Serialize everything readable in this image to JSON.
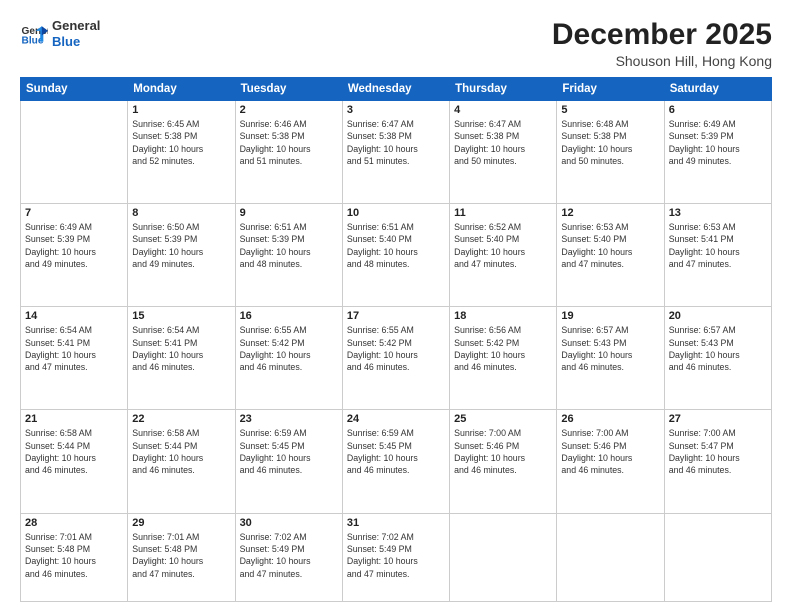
{
  "logo": {
    "line1": "General",
    "line2": "Blue"
  },
  "title": "December 2025",
  "subtitle": "Shouson Hill, Hong Kong",
  "days_header": [
    "Sunday",
    "Monday",
    "Tuesday",
    "Wednesday",
    "Thursday",
    "Friday",
    "Saturday"
  ],
  "weeks": [
    [
      {
        "day": "",
        "info": ""
      },
      {
        "day": "1",
        "info": "Sunrise: 6:45 AM\nSunset: 5:38 PM\nDaylight: 10 hours\nand 52 minutes."
      },
      {
        "day": "2",
        "info": "Sunrise: 6:46 AM\nSunset: 5:38 PM\nDaylight: 10 hours\nand 51 minutes."
      },
      {
        "day": "3",
        "info": "Sunrise: 6:47 AM\nSunset: 5:38 PM\nDaylight: 10 hours\nand 51 minutes."
      },
      {
        "day": "4",
        "info": "Sunrise: 6:47 AM\nSunset: 5:38 PM\nDaylight: 10 hours\nand 50 minutes."
      },
      {
        "day": "5",
        "info": "Sunrise: 6:48 AM\nSunset: 5:38 PM\nDaylight: 10 hours\nand 50 minutes."
      },
      {
        "day": "6",
        "info": "Sunrise: 6:49 AM\nSunset: 5:39 PM\nDaylight: 10 hours\nand 49 minutes."
      }
    ],
    [
      {
        "day": "7",
        "info": "Sunrise: 6:49 AM\nSunset: 5:39 PM\nDaylight: 10 hours\nand 49 minutes."
      },
      {
        "day": "8",
        "info": "Sunrise: 6:50 AM\nSunset: 5:39 PM\nDaylight: 10 hours\nand 49 minutes."
      },
      {
        "day": "9",
        "info": "Sunrise: 6:51 AM\nSunset: 5:39 PM\nDaylight: 10 hours\nand 48 minutes."
      },
      {
        "day": "10",
        "info": "Sunrise: 6:51 AM\nSunset: 5:40 PM\nDaylight: 10 hours\nand 48 minutes."
      },
      {
        "day": "11",
        "info": "Sunrise: 6:52 AM\nSunset: 5:40 PM\nDaylight: 10 hours\nand 47 minutes."
      },
      {
        "day": "12",
        "info": "Sunrise: 6:53 AM\nSunset: 5:40 PM\nDaylight: 10 hours\nand 47 minutes."
      },
      {
        "day": "13",
        "info": "Sunrise: 6:53 AM\nSunset: 5:41 PM\nDaylight: 10 hours\nand 47 minutes."
      }
    ],
    [
      {
        "day": "14",
        "info": "Sunrise: 6:54 AM\nSunset: 5:41 PM\nDaylight: 10 hours\nand 47 minutes."
      },
      {
        "day": "15",
        "info": "Sunrise: 6:54 AM\nSunset: 5:41 PM\nDaylight: 10 hours\nand 46 minutes."
      },
      {
        "day": "16",
        "info": "Sunrise: 6:55 AM\nSunset: 5:42 PM\nDaylight: 10 hours\nand 46 minutes."
      },
      {
        "day": "17",
        "info": "Sunrise: 6:55 AM\nSunset: 5:42 PM\nDaylight: 10 hours\nand 46 minutes."
      },
      {
        "day": "18",
        "info": "Sunrise: 6:56 AM\nSunset: 5:42 PM\nDaylight: 10 hours\nand 46 minutes."
      },
      {
        "day": "19",
        "info": "Sunrise: 6:57 AM\nSunset: 5:43 PM\nDaylight: 10 hours\nand 46 minutes."
      },
      {
        "day": "20",
        "info": "Sunrise: 6:57 AM\nSunset: 5:43 PM\nDaylight: 10 hours\nand 46 minutes."
      }
    ],
    [
      {
        "day": "21",
        "info": "Sunrise: 6:58 AM\nSunset: 5:44 PM\nDaylight: 10 hours\nand 46 minutes."
      },
      {
        "day": "22",
        "info": "Sunrise: 6:58 AM\nSunset: 5:44 PM\nDaylight: 10 hours\nand 46 minutes."
      },
      {
        "day": "23",
        "info": "Sunrise: 6:59 AM\nSunset: 5:45 PM\nDaylight: 10 hours\nand 46 minutes."
      },
      {
        "day": "24",
        "info": "Sunrise: 6:59 AM\nSunset: 5:45 PM\nDaylight: 10 hours\nand 46 minutes."
      },
      {
        "day": "25",
        "info": "Sunrise: 7:00 AM\nSunset: 5:46 PM\nDaylight: 10 hours\nand 46 minutes."
      },
      {
        "day": "26",
        "info": "Sunrise: 7:00 AM\nSunset: 5:46 PM\nDaylight: 10 hours\nand 46 minutes."
      },
      {
        "day": "27",
        "info": "Sunrise: 7:00 AM\nSunset: 5:47 PM\nDaylight: 10 hours\nand 46 minutes."
      }
    ],
    [
      {
        "day": "28",
        "info": "Sunrise: 7:01 AM\nSunset: 5:48 PM\nDaylight: 10 hours\nand 46 minutes."
      },
      {
        "day": "29",
        "info": "Sunrise: 7:01 AM\nSunset: 5:48 PM\nDaylight: 10 hours\nand 47 minutes."
      },
      {
        "day": "30",
        "info": "Sunrise: 7:02 AM\nSunset: 5:49 PM\nDaylight: 10 hours\nand 47 minutes."
      },
      {
        "day": "31",
        "info": "Sunrise: 7:02 AM\nSunset: 5:49 PM\nDaylight: 10 hours\nand 47 minutes."
      },
      {
        "day": "",
        "info": ""
      },
      {
        "day": "",
        "info": ""
      },
      {
        "day": "",
        "info": ""
      }
    ]
  ]
}
